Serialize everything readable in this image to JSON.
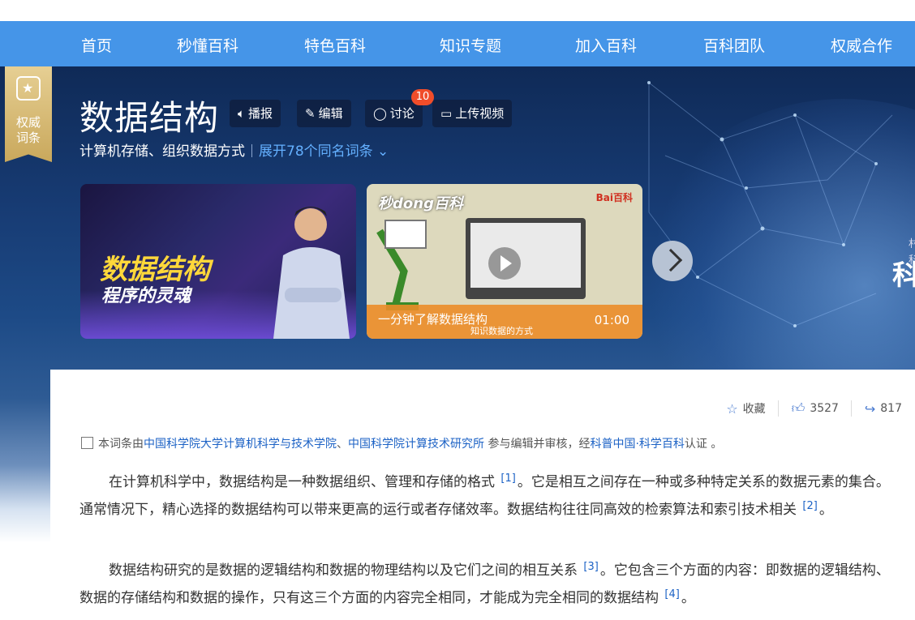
{
  "nav": {
    "items": [
      "首页",
      "秒懂百科",
      "特色百科",
      "知识专题",
      "加入百科",
      "百科团队",
      "权威合作"
    ]
  },
  "badge": {
    "label_line1": "权威",
    "label_line2": "词条"
  },
  "entry": {
    "title": "数据结构",
    "subtitle": "计算机存储、组织数据方式",
    "more_link": "展开78个同名词条",
    "discussion_count": "10"
  },
  "toolbar": {
    "broadcast": "播报",
    "edit": "编辑",
    "discuss": "讨论",
    "upload": "上传视频"
  },
  "icons": {
    "broadcast": "speaker-icon",
    "edit": "pencil-icon",
    "discuss": "comment-icon",
    "upload": "video-icon",
    "star": "star-icon",
    "like": "thumb-up-icon",
    "share": "share-icon"
  },
  "cards": {
    "card1": {
      "title": "数据结构",
      "subtitle": "程序的灵魂"
    },
    "card2": {
      "brand": "秒dong百科",
      "logo": "Bai百科",
      "caption": "一分钟了解数据结构",
      "caption_small": "知识数据的方式",
      "duration": "01:00"
    }
  },
  "hero_side": {
    "big_char": "科"
  },
  "actions": {
    "collect": "收藏",
    "likes": "3527",
    "shares": "817"
  },
  "cert": {
    "prefix": "本词条由",
    "org1": "中国科学院大学计算机科学与技术学院",
    "sep": "、",
    "org2": "中国科学院计算技术研究所",
    "middle": " 参与编辑并审核，经",
    "org3": "科普中国·科学百科",
    "suffix": "认证 。"
  },
  "para1": {
    "a": "在计算机科学中，数据结构是一种数据组织、管理和存储的格式 ",
    "ref1": "[1]",
    "b": "。它是相互之间存在一种或多种特定关系的数据元素的集合。通常情况下，精心选择的数据结构可以带来更高的运行或者存储效率。数据结构往往同高效的检索算法和索引技术相关 ",
    "ref2": "[2]",
    "c": "。"
  },
  "para2": {
    "a": "数据结构研究的是数据的逻辑结构和数据的物理结构以及它们之间的相互关系 ",
    "ref3": "[3]",
    "b": "。它包含三个方面的内容：即数据的逻辑结构、数据的存储结构和数据的操作，只有这三个方面的内容完全相同，才能成为完全相同的数据结构 ",
    "ref4": "[4]",
    "c": "。"
  }
}
